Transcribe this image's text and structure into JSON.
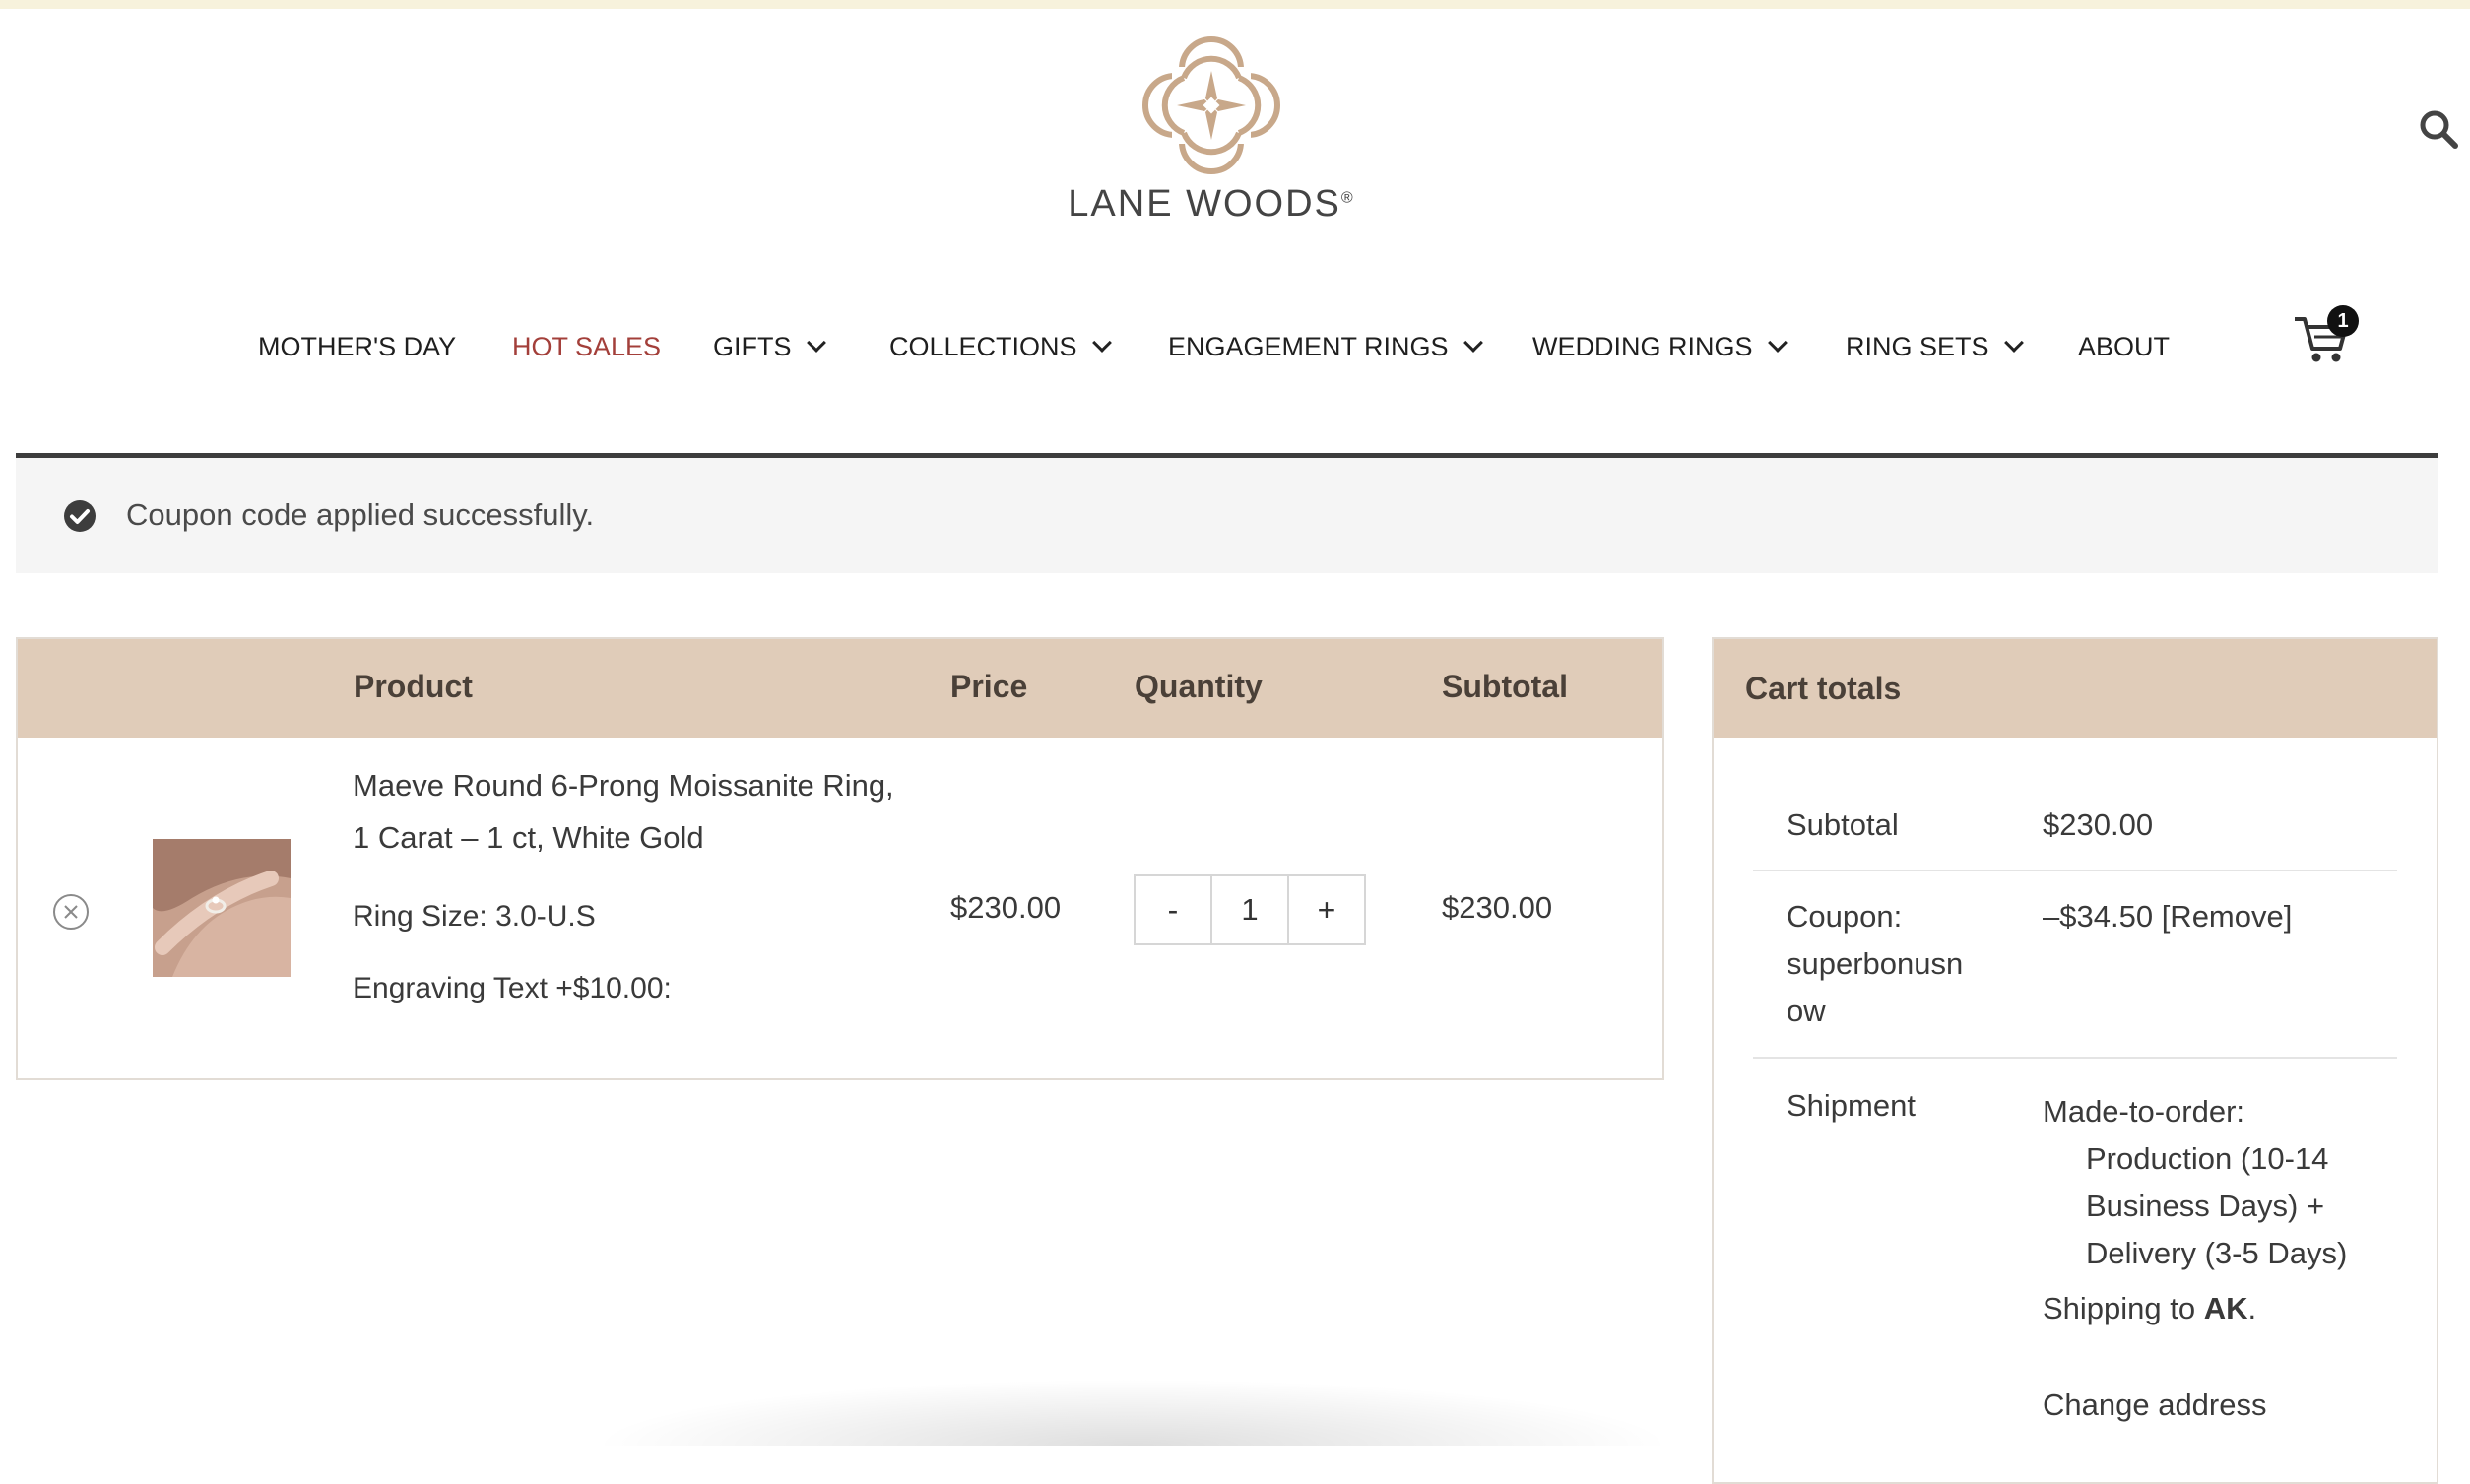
{
  "header": {
    "brand": "LANE WOODS",
    "brand_mark": "®"
  },
  "nav": {
    "items": [
      {
        "label": "MOTHER'S DAY",
        "dropdown": false
      },
      {
        "label": "HOT SALES",
        "dropdown": false,
        "highlight": "#a33f3a"
      },
      {
        "label": "GIFTS",
        "dropdown": true
      },
      {
        "label": "COLLECTIONS",
        "dropdown": true
      },
      {
        "label": "ENGAGEMENT RINGS",
        "dropdown": true
      },
      {
        "label": "WEDDING RINGS",
        "dropdown": true
      },
      {
        "label": "RING SETS",
        "dropdown": true
      },
      {
        "label": "ABOUT",
        "dropdown": false
      }
    ],
    "cart_count": "1"
  },
  "notice": {
    "text": "Coupon code applied successfully."
  },
  "cart_table": {
    "headers": {
      "product": "Product",
      "price": "Price",
      "quantity": "Quantity",
      "subtotal": "Subtotal"
    },
    "item": {
      "name": "Maeve Round 6-Prong Moissanite Ring, 1 Carat – 1 ct, White Gold",
      "ring_size": "Ring Size: 3.0-U.S",
      "engraving": "Engraving Text +$10.00:",
      "price": "$230.00",
      "quantity": "1",
      "decrement_label": "-",
      "increment_label": "+",
      "subtotal": "$230.00"
    }
  },
  "cart_totals": {
    "title": "Cart totals",
    "subtotal_label": "Subtotal",
    "subtotal_value": "$230.00",
    "coupon_label_line1": "Coupon:",
    "coupon_label_line2": "superbonusn",
    "coupon_label_line3": "ow",
    "coupon_value": "–$34.50",
    "coupon_remove": "[Remove]",
    "shipment_label": "Shipment",
    "shipment_line1": "Made-to-order:",
    "shipment_line2": "Production (10-14",
    "shipment_line3": "Business Days) +",
    "shipment_line4": "Delivery (3-5 Days)",
    "shipping_to_prefix": "Shipping to ",
    "shipping_to_state": "AK",
    "shipping_to_suffix": ".",
    "change_address": "Change address"
  },
  "colors": {
    "accent_tan": "#e0ccb9",
    "logo_tan": "#c8a88a",
    "hot_sales": "#a33f3a"
  }
}
